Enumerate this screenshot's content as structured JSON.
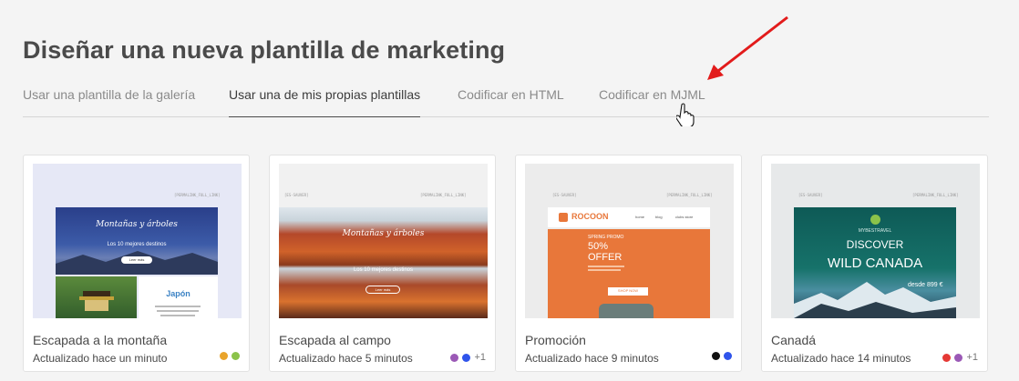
{
  "header": {
    "title": "Diseñar una nueva plantilla de marketing"
  },
  "tabs": [
    {
      "label": "Usar una plantilla de la galería"
    },
    {
      "label": "Usar una de mis propias plantillas"
    },
    {
      "label": "Codificar en HTML"
    },
    {
      "label": "Codificar en MJML"
    }
  ],
  "active_tab": "Usar una de mis propias plantillas",
  "cards": [
    {
      "name": "Escapada a la montaña",
      "updated": "Actualizado hace un minuto",
      "colors": [
        "#e9a42b",
        "#8bc34a"
      ],
      "more": "",
      "preview": {
        "tag_right": "[PERMALINK_FULL_LINK]",
        "heading": "Montañas y árboles",
        "sub": "Los 10 mejores destinos",
        "button": "Leer más",
        "side_title": "Japón"
      }
    },
    {
      "name": "Escapada al campo",
      "updated": "Actualizado hace 5 minutos",
      "colors": [
        "#9b59b6",
        "#2f54eb"
      ],
      "more": "+1",
      "preview": {
        "tag_left": "[ES-SAUVER]",
        "tag_right": "[PERMALINK_FULL_LINK]",
        "heading": "Montañas y árboles",
        "sub": "Los 10 mejores destinos",
        "button": "Leer más"
      }
    },
    {
      "name": "Promoción",
      "updated": "Actualizado hace 9 minutos",
      "colors": [
        "#111111",
        "#2f54eb"
      ],
      "more": "",
      "preview": {
        "tag_left": "[ES-SAUVER]",
        "tag_right": "[PERMALINK_FULL_LINK]",
        "brand": "ROCOON",
        "nav": [
          "home",
          "blog",
          "clubs store"
        ],
        "promo_small": "SPRING PROMO",
        "promo_big1": "50%",
        "promo_big2": "OFFER",
        "button": "SHOP NOW"
      }
    },
    {
      "name": "Canadá",
      "updated": "Actualizado hace 14 minutos",
      "colors": [
        "#e53935",
        "#9b59b6"
      ],
      "more": "+1",
      "preview": {
        "tag_left": "[ES-SAUVER]",
        "tag_right": "[PERMALINK_FULL_LINK]",
        "brand": "MYBESTRAVEL",
        "line1": "DISCOVER",
        "line2": "WILD CANADA",
        "price": "desde 899 €"
      }
    }
  ]
}
